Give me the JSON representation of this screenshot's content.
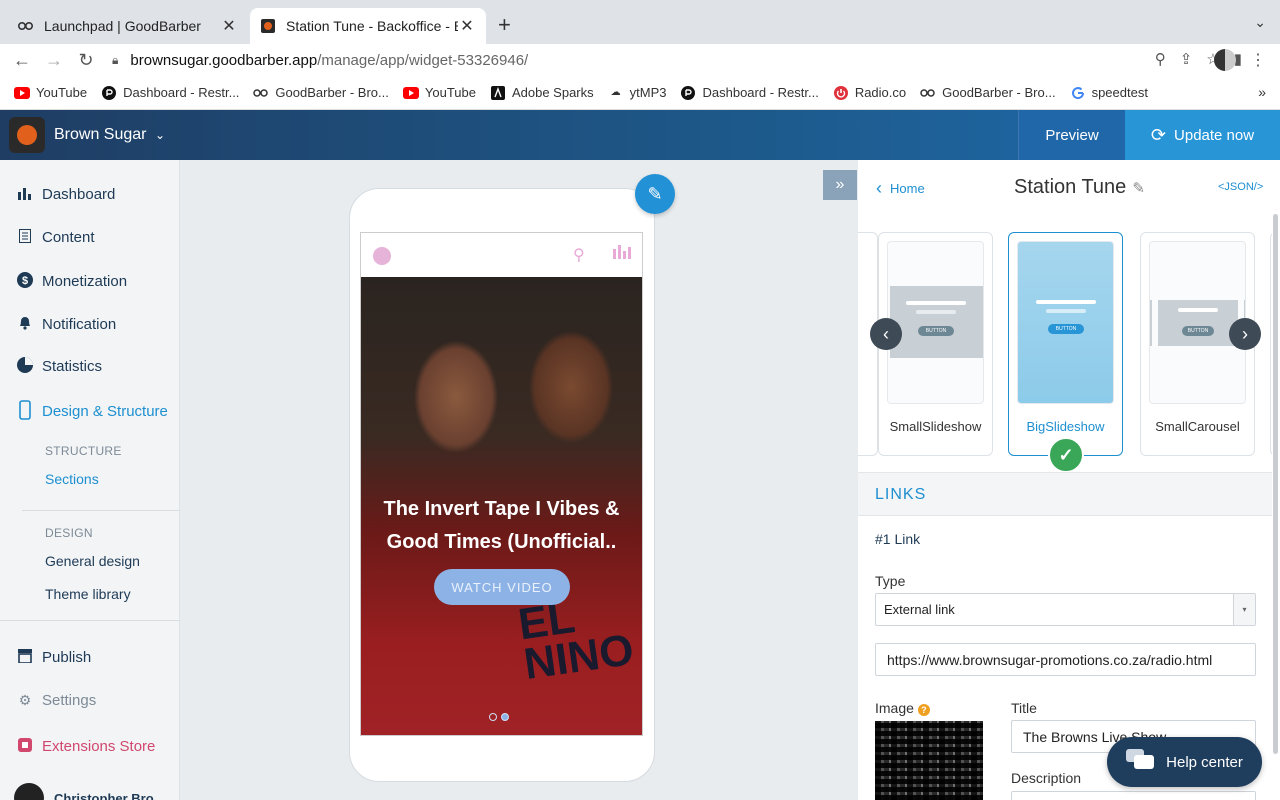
{
  "browser": {
    "tabs": [
      {
        "title": "Launchpad | GoodBarber"
      },
      {
        "title": "Station Tune - Backoffice - Bro"
      }
    ],
    "url_host": "brownsugar.goodbarber.app",
    "url_path": "/manage/app/widget-53326946/",
    "bookmarks": [
      {
        "label": "YouTube",
        "icon": "youtube-icon"
      },
      {
        "label": "Dashboard - Restr...",
        "icon": "restream-icon"
      },
      {
        "label": "GoodBarber - Bro...",
        "icon": "goodbarber-icon"
      },
      {
        "label": "YouTube",
        "icon": "youtube-icon"
      },
      {
        "label": "Adobe Sparks",
        "icon": "adobe-icon"
      },
      {
        "label": "ytMP3",
        "icon": "cloud-download-icon"
      },
      {
        "label": "Dashboard - Restr...",
        "icon": "restream-icon"
      },
      {
        "label": "Radio.co",
        "icon": "radio-icon"
      },
      {
        "label": "GoodBarber - Bro...",
        "icon": "goodbarber-icon"
      },
      {
        "label": "speedtest",
        "icon": "google-icon"
      }
    ]
  },
  "header": {
    "app_name": "Brown Sugar",
    "preview_label": "Preview",
    "update_label": "Update now"
  },
  "sidebar": {
    "items": [
      {
        "label": "Dashboard",
        "icon": "bar-chart-icon"
      },
      {
        "label": "Content",
        "icon": "document-icon"
      },
      {
        "label": "Monetization",
        "icon": "dollar-icon"
      },
      {
        "label": "Notification",
        "icon": "bell-icon"
      },
      {
        "label": "Statistics",
        "icon": "pie-chart-icon"
      },
      {
        "label": "Design & Structure",
        "icon": "phone-icon"
      }
    ],
    "structure_heading": "STRUCTURE",
    "sections_label": "Sections",
    "design_heading": "DESIGN",
    "general_design_label": "General design",
    "theme_library_label": "Theme library",
    "publish_label": "Publish",
    "settings_label": "Settings",
    "extensions_label": "Extensions Store",
    "user_name": "Christopher Bro..."
  },
  "phone": {
    "slide_title": "The Invert Tape I Vibes & Good Times (Unofficial..",
    "cta_label": "WATCH VIDEO",
    "photo_text": "EL NINO"
  },
  "panel": {
    "back_label": "Home",
    "title": "Station Tune",
    "json_label": "<JSON/>",
    "templates": [
      {
        "label": "SmallSlideshow",
        "selected": false
      },
      {
        "label": "BigSlideshow",
        "selected": true
      },
      {
        "label": "SmallCarousel",
        "selected": false
      }
    ],
    "mock_button_text": "BUTTON",
    "links_heading": "LINKS",
    "link_number": "#1 Link",
    "type_label": "Type",
    "type_value": "External link",
    "url_value": "https://www.brownsugar-promotions.co.za/radio.html",
    "image_label": "Image",
    "title_label": "Title",
    "title_value": "The Browns Live Show",
    "description_label": "Description",
    "help_label": "Help center"
  }
}
